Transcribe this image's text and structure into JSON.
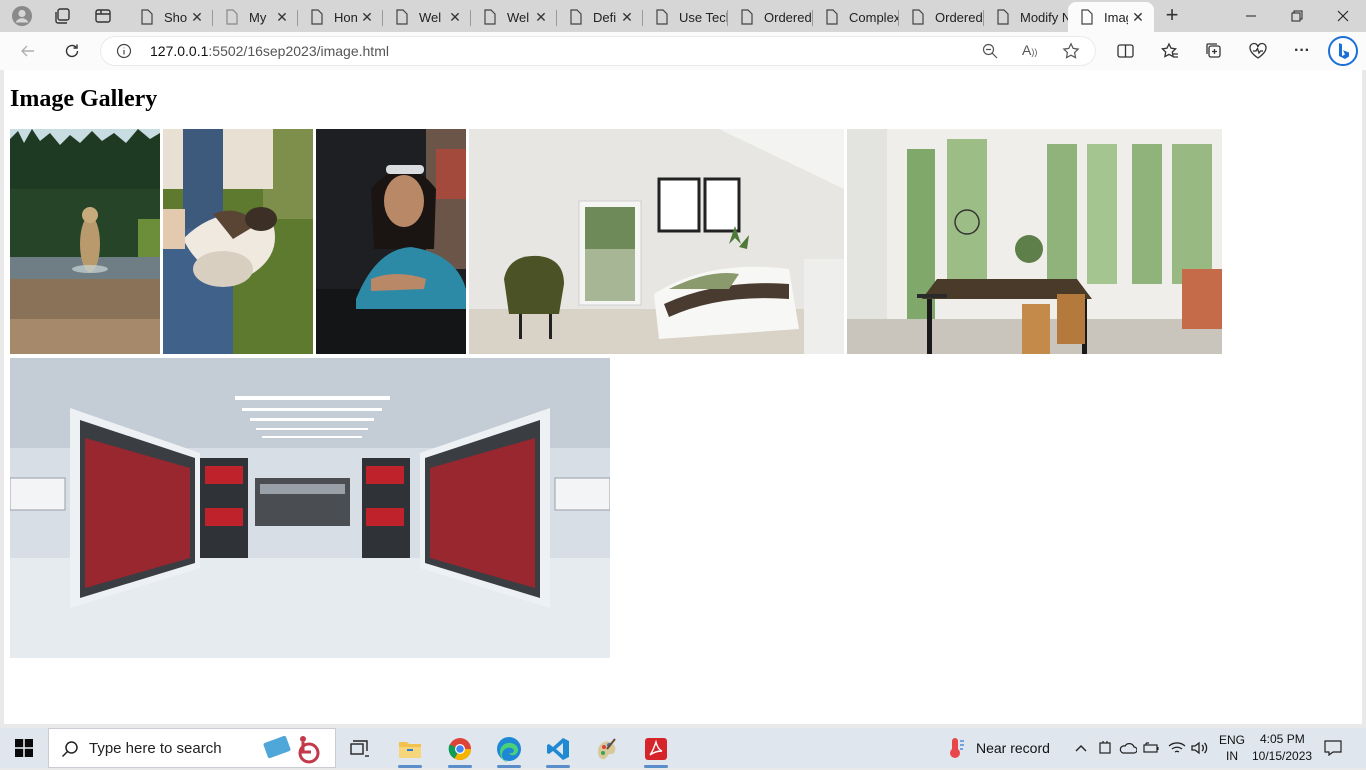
{
  "browser": {
    "tabs": [
      {
        "title": "Sho"
      },
      {
        "title": "My "
      },
      {
        "title": "Hon"
      },
      {
        "title": "Wel"
      },
      {
        "title": "Wel"
      },
      {
        "title": "Defi"
      },
      {
        "title": "Use Tech"
      },
      {
        "title": "Ordered"
      },
      {
        "title": "Complex"
      },
      {
        "title": "Ordered"
      },
      {
        "title": "Modify N"
      },
      {
        "title": "Imag"
      }
    ],
    "new_tab_label": "+",
    "address": {
      "host": "127.0.0.1",
      "path": ":5502/16sep2023/image.html"
    }
  },
  "page": {
    "heading": "Image Gallery",
    "images": [
      {
        "subject": "dog wading in forest lake"
      },
      {
        "subject": "person holding a baby goat"
      },
      {
        "subject": "woman with sunglasses on head"
      },
      {
        "subject": "bright bedroom with green armchair"
      },
      {
        "subject": "dining room with large windows"
      },
      {
        "subject": "library aisle with red and black binders"
      }
    ]
  },
  "taskbar": {
    "search_placeholder": "Type here to search",
    "weather": "Near record",
    "language_line1": "ENG",
    "language_line2": "IN",
    "time": "4:05 PM",
    "date": "10/15/2023",
    "accent_color": "#0078d4"
  }
}
